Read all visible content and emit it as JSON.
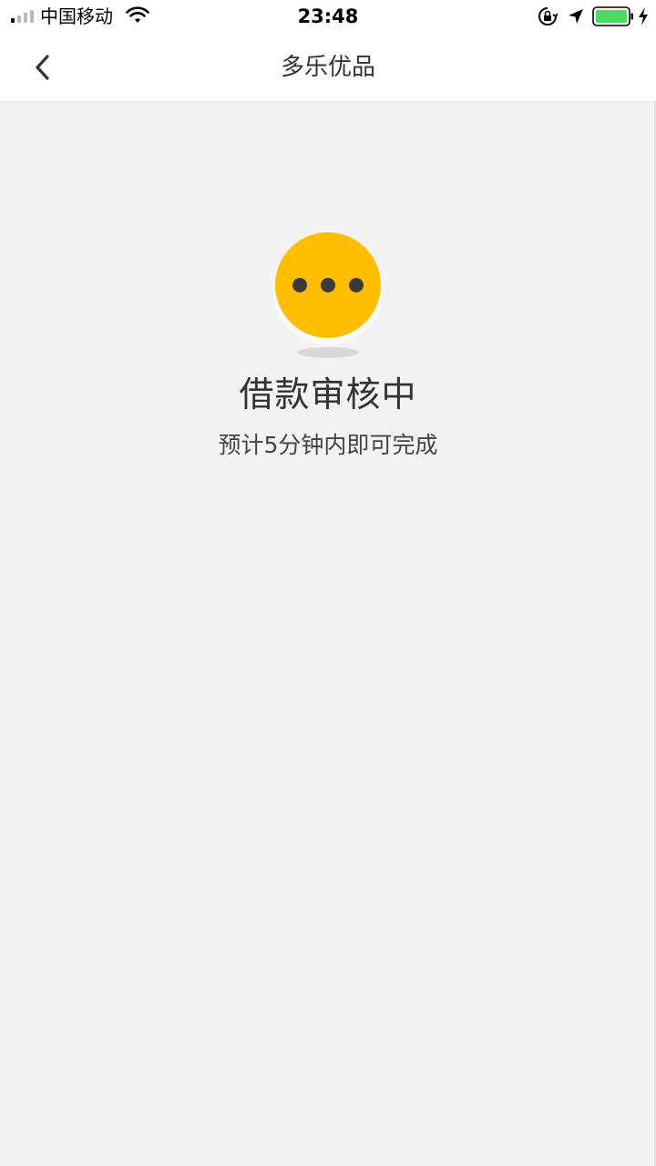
{
  "status_bar": {
    "carrier": "中国移动",
    "time": "23:48",
    "icons": [
      "signal-icon",
      "wifi-icon",
      "rotation-lock-icon",
      "location-arrow-icon",
      "battery-icon",
      "charging-bolt-icon"
    ],
    "battery_color": "#4cd964"
  },
  "nav": {
    "title": "多乐优品",
    "back_icon": "chevron-left-icon"
  },
  "status": {
    "icon": "pending-dots-icon",
    "icon_color": "#ffbf00",
    "title": "借款审核中",
    "subtitle": "预计5分钟内即可完成"
  }
}
